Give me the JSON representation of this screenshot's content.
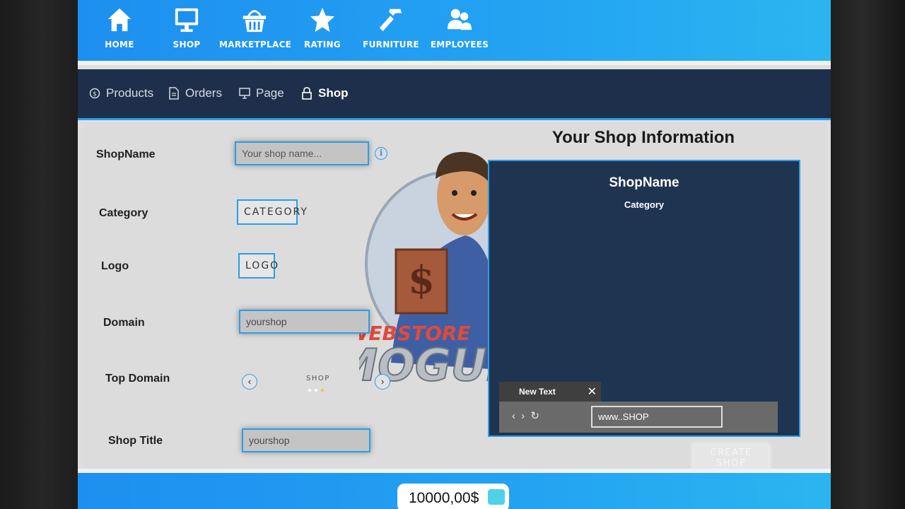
{
  "topnav": {
    "items": [
      {
        "label": "HOME",
        "icon": "home-icon"
      },
      {
        "label": "SHOP",
        "icon": "monitor-icon"
      },
      {
        "label": "MARKETPLACE",
        "icon": "basket-icon"
      },
      {
        "label": "RATING",
        "icon": "star-icon"
      },
      {
        "label": "FURNITURE",
        "icon": "hammer-icon"
      },
      {
        "label": "EMPLOYEES",
        "icon": "users-icon"
      }
    ]
  },
  "subnav": {
    "items": [
      {
        "label": "Products",
        "icon": "dollar-circle-icon"
      },
      {
        "label": "Orders",
        "icon": "document-icon"
      },
      {
        "label": "Page",
        "icon": "monitor-icon"
      },
      {
        "label": "Shop",
        "icon": "lock-icon",
        "active": true
      }
    ]
  },
  "form": {
    "shop_name_label": "ShopName",
    "shop_name_placeholder": "Your shop name...",
    "category_label": "Category",
    "category_button": "CATEGORY",
    "logo_label": "Logo",
    "logo_button": "LOGO",
    "domain_label": "Domain",
    "domain_value": "yourshop",
    "top_domain_label": "Top Domain",
    "top_domain_value": "SHOP",
    "shop_title_label": "Shop Title",
    "shop_title_value": "yourshop"
  },
  "logo": {
    "text_top": "WEBSTORE",
    "text_bottom": "MOGUL"
  },
  "preview": {
    "title": "Your Shop Information",
    "shop_name": "ShopName",
    "category": "Category",
    "tab_label": "New Text",
    "url": "www..SHOP"
  },
  "create_button": "CREATE SHOP",
  "balance": "10000,00$",
  "colors": {
    "accent": "#2a9ee8",
    "navy": "#1e3450",
    "nav_blue": "#1d8ff0"
  }
}
